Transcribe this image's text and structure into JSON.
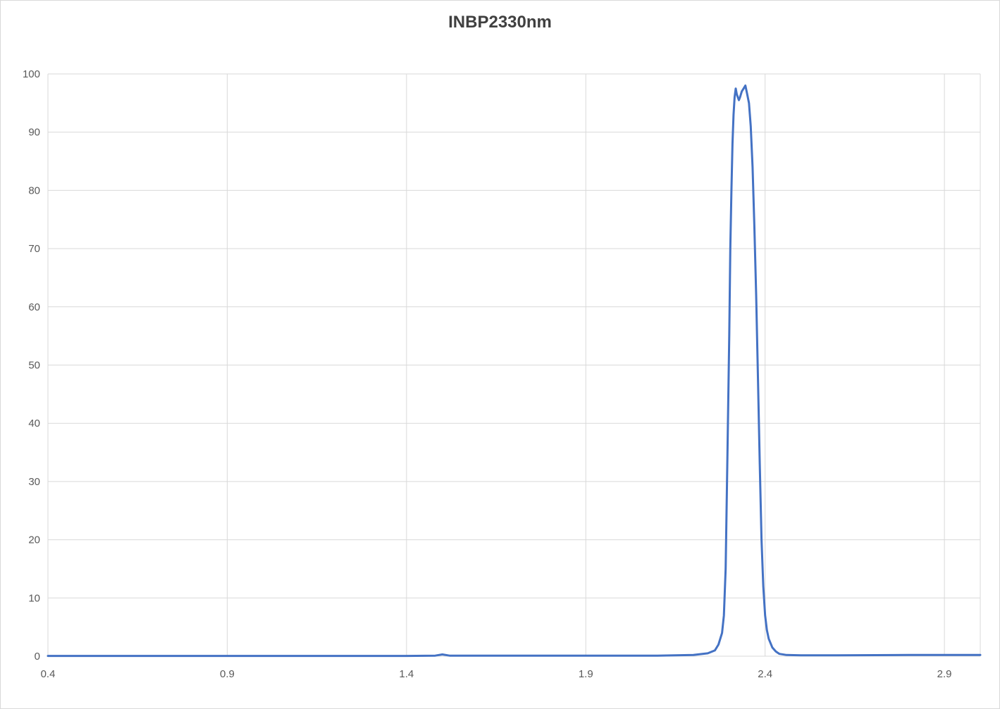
{
  "chart_data": {
    "type": "line",
    "title": "INBP2330nm",
    "xlabel": "",
    "ylabel": "",
    "xlim": [
      0.4,
      3.0
    ],
    "ylim": [
      0,
      100
    ],
    "x_ticks": [
      0.4,
      0.9,
      1.4,
      1.9,
      2.4,
      2.9
    ],
    "x_tick_labels": [
      "0.4",
      "0.9",
      "1.4",
      "1.9",
      "2.4",
      "2.9"
    ],
    "y_ticks": [
      0,
      10,
      20,
      30,
      40,
      50,
      60,
      70,
      80,
      90,
      100
    ],
    "y_tick_labels": [
      "0",
      "10",
      "20",
      "30",
      "40",
      "50",
      "60",
      "70",
      "80",
      "90",
      "100"
    ],
    "grid": true,
    "legend": "none",
    "colors": {
      "series": "#4472c4",
      "grid": "#d9d9d9"
    },
    "series": [
      {
        "x": [
          0.4,
          0.9,
          1.4,
          1.48,
          1.5,
          1.52,
          1.9,
          2.1,
          2.2,
          2.24,
          2.26,
          2.27,
          2.28,
          2.285,
          2.29,
          2.295,
          2.3,
          2.303,
          2.306,
          2.309,
          2.312,
          2.315,
          2.318,
          2.321,
          2.324,
          2.327,
          2.33,
          2.335,
          2.34,
          2.345,
          2.35,
          2.355,
          2.36,
          2.365,
          2.37,
          2.375,
          2.38,
          2.385,
          2.39,
          2.395,
          2.4,
          2.405,
          2.41,
          2.42,
          2.43,
          2.44,
          2.46,
          2.5,
          2.6,
          2.8,
          3.0
        ],
        "y": [
          0.05,
          0.05,
          0.05,
          0.1,
          0.3,
          0.1,
          0.1,
          0.1,
          0.2,
          0.5,
          1.0,
          2.0,
          4.0,
          7.0,
          15.0,
          35.0,
          55.0,
          70.0,
          80.0,
          88.0,
          93.0,
          96.0,
          97.5,
          96.5,
          96.0,
          95.5,
          96.0,
          97.0,
          97.5,
          98.0,
          96.5,
          95.0,
          91.0,
          84.0,
          74.0,
          62.0,
          48.0,
          33.0,
          20.0,
          12.0,
          7.0,
          4.5,
          3.0,
          1.5,
          0.8,
          0.4,
          0.2,
          0.15,
          0.15,
          0.2,
          0.2
        ]
      }
    ]
  }
}
